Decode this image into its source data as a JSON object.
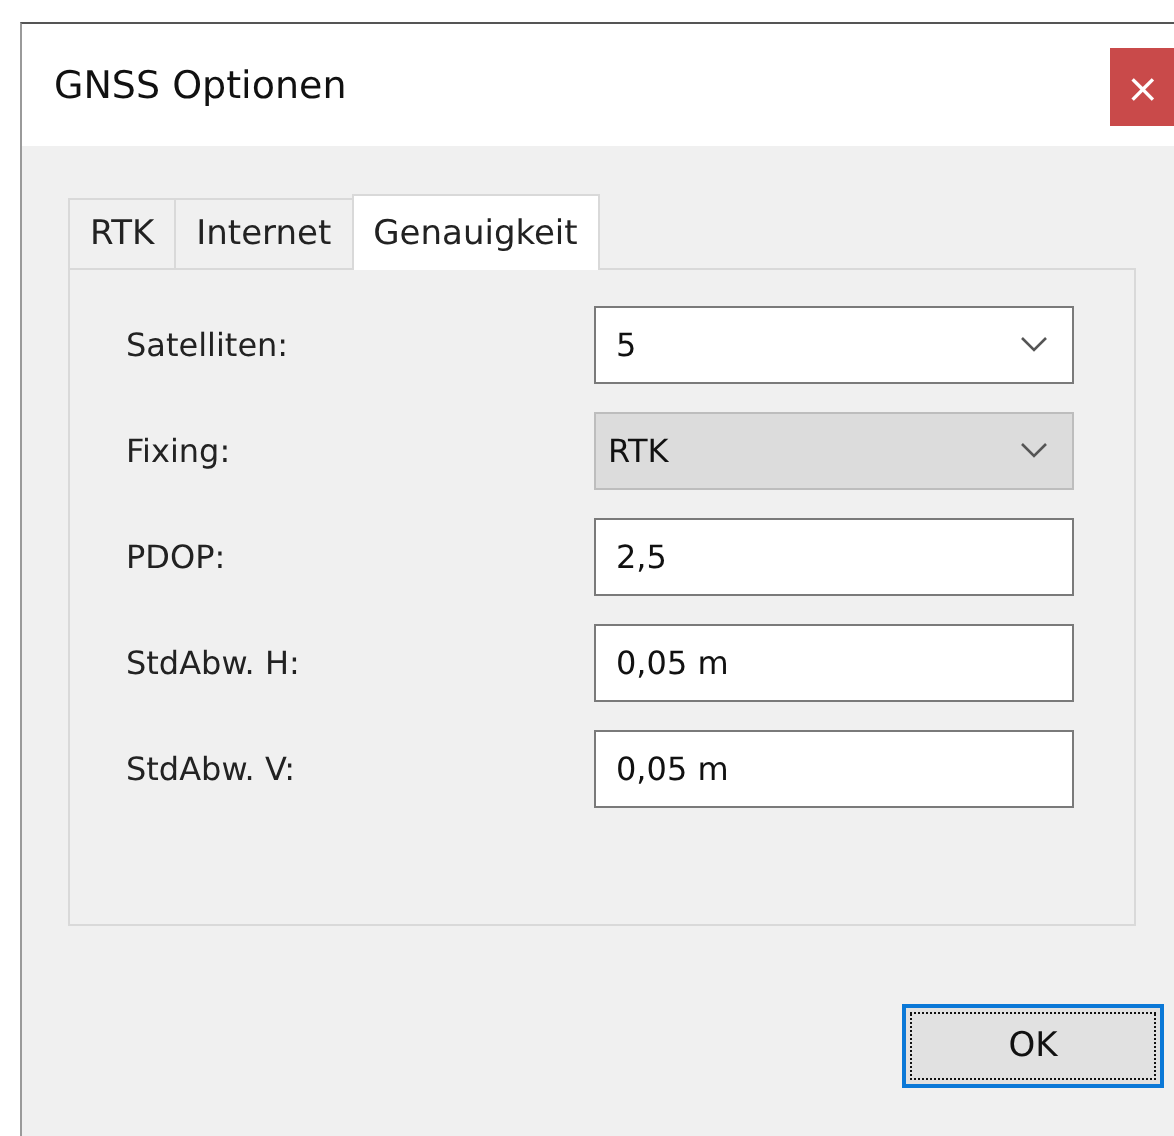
{
  "window": {
    "title": "GNSS Optionen",
    "close": "×"
  },
  "tabs": [
    {
      "label": "RTK",
      "selected": false
    },
    {
      "label": "Internet",
      "selected": false
    },
    {
      "label": "Genauigkeit",
      "selected": true
    }
  ],
  "fields": [
    {
      "label": "Satelliten:",
      "kind": "combo",
      "value": "5",
      "disabled": false
    },
    {
      "label": "Fixing:",
      "kind": "combo",
      "value": "RTK",
      "disabled": true
    },
    {
      "label": "PDOP:",
      "kind": "text",
      "value": "2,5",
      "disabled": false
    },
    {
      "label": "StdAbw. H:",
      "kind": "text",
      "value": "0,05 m",
      "disabled": false
    },
    {
      "label": "StdAbw. V:",
      "kind": "text",
      "value": "0,05 m",
      "disabled": false
    }
  ],
  "buttons": [
    {
      "label": "OK",
      "focused": true
    }
  ]
}
